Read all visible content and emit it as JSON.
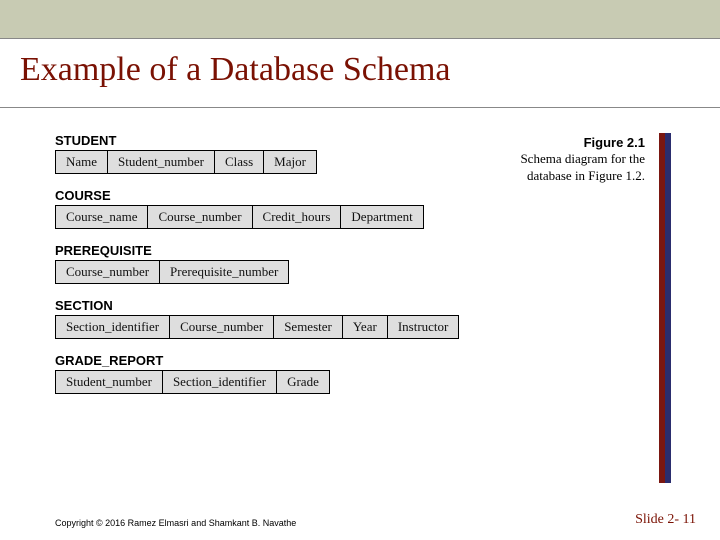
{
  "title": "Example of a Database Schema",
  "figure": {
    "label": "Figure 2.1",
    "caption_line1": "Schema diagram for the",
    "caption_line2": "database in Figure 1.2."
  },
  "tables": {
    "student": {
      "name": "STUDENT",
      "cols": [
        "Name",
        "Student_number",
        "Class",
        "Major"
      ]
    },
    "course": {
      "name": "COURSE",
      "cols": [
        "Course_name",
        "Course_number",
        "Credit_hours",
        "Department"
      ]
    },
    "prerequisite": {
      "name": "PREREQUISITE",
      "cols": [
        "Course_number",
        "Prerequisite_number"
      ]
    },
    "section": {
      "name": "SECTION",
      "cols": [
        "Section_identifier",
        "Course_number",
        "Semester",
        "Year",
        "Instructor"
      ]
    },
    "grade_report": {
      "name": "GRADE_REPORT",
      "cols": [
        "Student_number",
        "Section_identifier",
        "Grade"
      ]
    }
  },
  "footer": {
    "copyright": "Copyright © 2016 Ramez Elmasri and Shamkant B. Navathe",
    "slide": "Slide 2- 11"
  }
}
